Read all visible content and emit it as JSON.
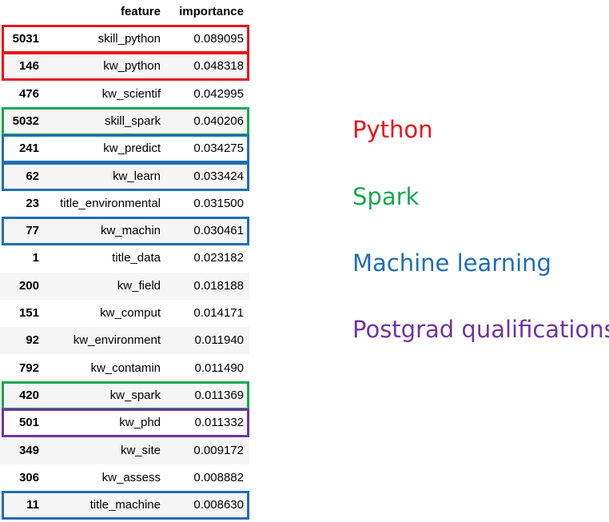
{
  "header": {
    "feature": "feature",
    "importance": "importance"
  },
  "rows": [
    {
      "index": "5031",
      "feature": "skill_python",
      "importance": "0.089095",
      "group": "python"
    },
    {
      "index": "146",
      "feature": "kw_python",
      "importance": "0.048318",
      "group": "python"
    },
    {
      "index": "476",
      "feature": "kw_scientif",
      "importance": "0.042995",
      "group": ""
    },
    {
      "index": "5032",
      "feature": "skill_spark",
      "importance": "0.040206",
      "group": "spark"
    },
    {
      "index": "241",
      "feature": "kw_predict",
      "importance": "0.034275",
      "group": "ml"
    },
    {
      "index": "62",
      "feature": "kw_learn",
      "importance": "0.033424",
      "group": "ml"
    },
    {
      "index": "23",
      "feature": "title_environmental",
      "importance": "0.031500",
      "group": ""
    },
    {
      "index": "77",
      "feature": "kw_machin",
      "importance": "0.030461",
      "group": "ml"
    },
    {
      "index": "1",
      "feature": "title_data",
      "importance": "0.023182",
      "group": ""
    },
    {
      "index": "200",
      "feature": "kw_field",
      "importance": "0.018188",
      "group": ""
    },
    {
      "index": "151",
      "feature": "kw_comput",
      "importance": "0.014171",
      "group": ""
    },
    {
      "index": "92",
      "feature": "kw_environment",
      "importance": "0.011940",
      "group": ""
    },
    {
      "index": "792",
      "feature": "kw_contamin",
      "importance": "0.011490",
      "group": ""
    },
    {
      "index": "420",
      "feature": "kw_spark",
      "importance": "0.011369",
      "group": "spark"
    },
    {
      "index": "501",
      "feature": "kw_phd",
      "importance": "0.011332",
      "group": "postgrad"
    },
    {
      "index": "349",
      "feature": "kw_site",
      "importance": "0.009172",
      "group": ""
    },
    {
      "index": "306",
      "feature": "kw_assess",
      "importance": "0.008882",
      "group": ""
    },
    {
      "index": "11",
      "feature": "title_machine",
      "importance": "0.008630",
      "group": "ml"
    }
  ],
  "legend": [
    {
      "label": "Python",
      "group": "python",
      "color": "#e8151b"
    },
    {
      "label": "Spark",
      "group": "spark",
      "color": "#17a84f"
    },
    {
      "label": "Machine learning",
      "group": "ml",
      "color": "#1f6eb5"
    },
    {
      "label": "Postgrad qualifications",
      "group": "postgrad",
      "color": "#7133a0"
    }
  ],
  "colors": {
    "python": "#e8151b",
    "spark": "#17a84f",
    "ml": "#1f6eb5",
    "postgrad": "#7133a0",
    "row_shade": "#f5f5f5"
  }
}
